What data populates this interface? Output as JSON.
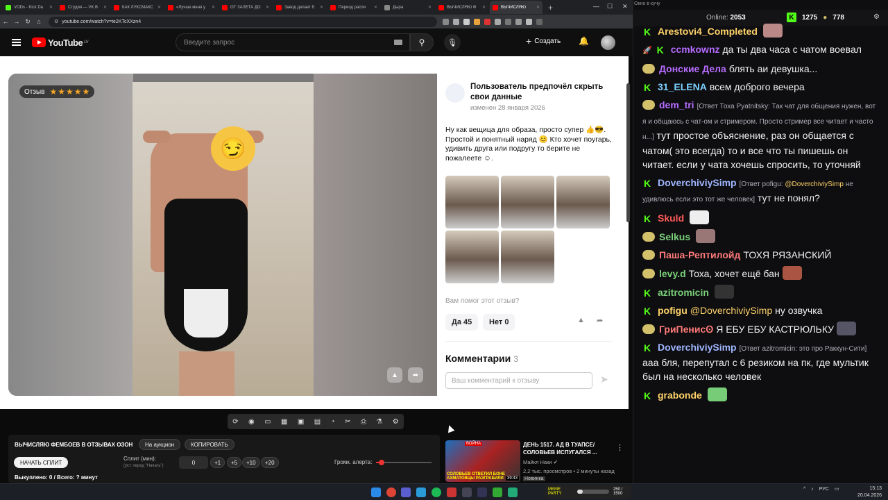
{
  "browser": {
    "tabs": [
      {
        "label": "VODs - Kick Da",
        "color": "#53fc18"
      },
      {
        "label": "Студия — VK В",
        "color": "#f00"
      },
      {
        "label": "КАК ЛУКСМАКС",
        "color": "#f00"
      },
      {
        "label": "«Лучше меня у",
        "color": "#f00"
      },
      {
        "label": "ОТ ЗАЛЕТА ДО",
        "color": "#f00"
      },
      {
        "label": "Завод делает б",
        "color": "#f00"
      },
      {
        "label": "Период распи",
        "color": "#f00"
      },
      {
        "label": "Дыра",
        "color": "#888"
      },
      {
        "label": "ВЫЧИСЛЯЮ Ф",
        "color": "#f00"
      },
      {
        "label": "ВЫЧИСЛЯЮ",
        "color": "#f00",
        "active": true
      }
    ],
    "url": "youtube.com/watch?v=te2KTcXXzn4"
  },
  "youtube": {
    "logo_text": "YouTube",
    "region": "LV",
    "search_placeholder": "Введите запрос",
    "create_label": "Создать"
  },
  "review": {
    "badge_label": "Отзыв",
    "stars": 5,
    "author": "Пользователь предпочёл скрыть свои данные",
    "date": "изменен 28 января 2026",
    "text": "Ну как вещица для образа, просто супер 👍😎. Простой и понятный наряд 😊 Кто хочет поугарь, удивить друга или подругу то берите не пожалеете ☺.",
    "help_question": "Вам помог этот отзыв?",
    "yes_label": "Да 45",
    "no_label": "Нет 0",
    "comments_title": "Комментарии",
    "comments_count": "3",
    "comment_placeholder": "Ваш комментарий к отзыву"
  },
  "panel": {
    "title": "ВЫЧИСЛЯЮ ФЕМБОЕВ В ОТЗЫВАХ ОЗОН",
    "auction_label": "На аукцион",
    "copy_label": "КОПИРОВАТЬ",
    "start_label": "НАЧАТЬ СПЛИТ",
    "split_label": "Сплит (мин):",
    "split_hint": "(уст. перед \"Начать\")",
    "split_value": "0",
    "increments": [
      "+1",
      "+5",
      "+10",
      "+20"
    ],
    "alert_label": "Громк. алерта:",
    "alert_level": 0.1,
    "bought": "Выкуплено: 0 / Всего: ? минут"
  },
  "recommendation": {
    "title": "ДЕНЬ 1517. АД В ТУАПСЕ/ СОЛОВЬЕВ ИСПУГАЛСЯ ...",
    "channel": "Майкл Наки",
    "meta": "2,2 тыс. просмотров • 2 минуты назад",
    "badge": "Новинка",
    "thumb_text": "СОЛОВЬЕВ ОТВЕТИЛ БОНЕ АХМАТОВЦЫ РАЗГРАБИЛИ",
    "thumb_tag": "ВОЙНА",
    "duration": "39:43"
  },
  "chat": {
    "window_title": "Окно в кучу",
    "online_label": "Online:",
    "online_count": "2053",
    "count_k": "1275",
    "count_g": "778",
    "messages": [
      {
        "badge": "k",
        "user": "Arestovi4_Completed",
        "color": "#ffd36a",
        "text": "",
        "emote": "#b88"
      },
      {
        "badge": "rk",
        "user": "ccmkownz",
        "color": "#b56cff",
        "text": "да ты два часа с чатом воевал"
      },
      {
        "badge": "g",
        "user": "Донские Дела",
        "color": "#b56cff",
        "text": "блять аи девушка..."
      },
      {
        "badge": "k",
        "user": "31_ELENA",
        "color": "#7bd0ff",
        "text": "всем доброго вечера"
      },
      {
        "badge": "g",
        "user": "dem_tri",
        "color": "#b56cff",
        "reply": "[Ответ Тоха Pyatnitsky: Так чат для общения нужен, вот я и общаюсь с чат-ом и стримером. Просто стример все читает и часто н...]",
        "text": "тут простое объяснение, раз он общается с чатом( это всегда) то и все что ты пишешь он читает. если у чата хочешь спросить, то уточняй"
      },
      {
        "badge": "k",
        "user": "DoverchiviySimp",
        "color": "#9fb6ff",
        "reply": "[Ответ pofigu: ",
        "mention": "@DoverchiviySimp",
        "reply_tail": " не удивлюсь если это тот же человек]",
        "text": "тут не понял?"
      },
      {
        "badge": "k",
        "user": "Skuld",
        "color": "#ff5a5a",
        "text": "",
        "emote": "#eee"
      },
      {
        "badge": "g",
        "user": "Selkus",
        "color": "#7bd07b",
        "text": "",
        "emote": "#977"
      },
      {
        "badge": "g",
        "user": "Паша-Рептилойд",
        "color": "#ff7a7a",
        "text": "ТОХЯ РЯЗАНСКИЙ"
      },
      {
        "badge": "g",
        "user": "levy.d",
        "color": "#7bd07b",
        "text": "Тоха, хочет ещё бан",
        "emote": "#a54"
      },
      {
        "badge": "k",
        "user": "azitromicin",
        "color": "#7bd07b",
        "text": "",
        "emote": "#333"
      },
      {
        "badge": "k",
        "user": "pofigu",
        "color": "#ffd36a",
        "mention": "@DoverchiviySimp",
        "text": " ну озвучка"
      },
      {
        "badge": "g",
        "user": "ГриПенисꙨ",
        "color": "#ff7a7a",
        "text": "Я ЕБУ ЕБУ КАСТРЮЛЬКУ",
        "emote": "#556"
      },
      {
        "badge": "k",
        "user": "DoverchiviySimp",
        "color": "#9fb6ff",
        "reply": "[Ответ azitromicin: это про Раккун-Сити]",
        "text": "ааа бля, перепутал с 6 резиком на пк, где мультик был на несколько человек"
      },
      {
        "badge": "k",
        "user": "grabonde",
        "color": "#ffd36a",
        "text": "",
        "emote": "#7c7"
      }
    ]
  },
  "taskbar": {
    "meme_label": "MEME PARTY",
    "meme_progress_text": "250 / 1500",
    "meme_progress": 0.1667,
    "lang": "РУС",
    "time": "15:13",
    "date": "20.04.2026"
  }
}
